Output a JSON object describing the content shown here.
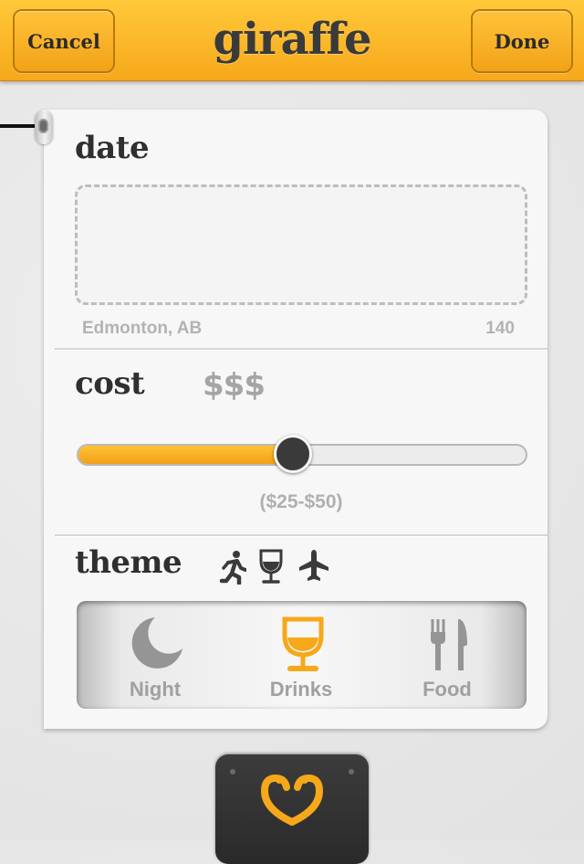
{
  "header": {
    "cancel_label": "Cancel",
    "title": "giraffe",
    "done_label": "Done"
  },
  "date_section": {
    "label": "date",
    "location": "Edmonton, AB",
    "char_count": "140"
  },
  "cost_section": {
    "label": "cost",
    "price_symbols": "$$$",
    "range_text": "($25-$50)",
    "slider_level": 0.48
  },
  "theme_section": {
    "label": "theme",
    "header_icons": [
      "running-person-icon",
      "wine-glass-icon",
      "airplane-icon"
    ],
    "options": [
      {
        "label": "Night",
        "icon": "moon-icon",
        "selected": false
      },
      {
        "label": "Drinks",
        "icon": "wine-glass-icon",
        "selected": true
      },
      {
        "label": "Food",
        "icon": "fork-knife-icon",
        "selected": false
      }
    ]
  },
  "colors": {
    "accent": "#f6a81a",
    "header_text": "#2b2b2b",
    "inactive": "#a0a0a0",
    "dark": "#3a3a3a"
  },
  "dock": {
    "icon": "giraffe-logo-icon"
  }
}
